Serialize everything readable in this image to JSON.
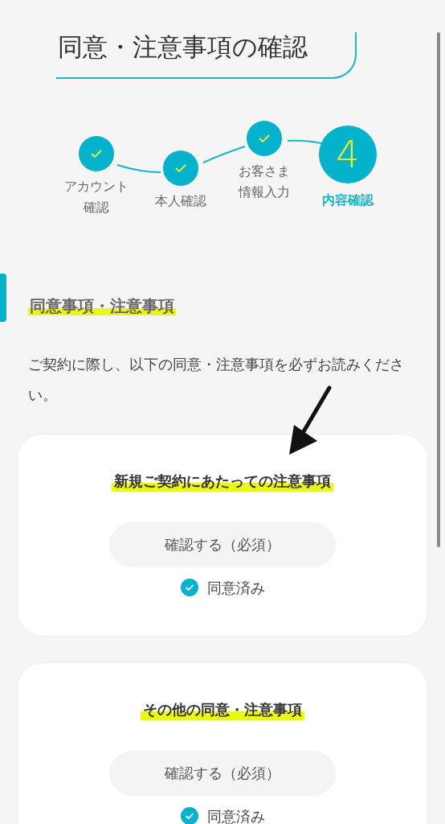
{
  "page_title": "同意・注意事項の確認",
  "steps": [
    {
      "label_lines": [
        "アカウント",
        "確認"
      ],
      "done": true,
      "current": false
    },
    {
      "label_lines": [
        "本人確認"
      ],
      "done": true,
      "current": false
    },
    {
      "label_lines": [
        "お客さま",
        "情報入力"
      ],
      "done": true,
      "current": false
    },
    {
      "label_lines": [
        "内容確認"
      ],
      "number": "4",
      "done": false,
      "current": true
    }
  ],
  "section_heading": "同意事項・注意事項",
  "intro": "ご契約に際し、以下の同意・注意事項を必ずお読みください。",
  "items": [
    {
      "title": "新規ご契約にあたっての注意事項",
      "button": "確認する（必須）",
      "status": "同意済み",
      "agreed": true
    },
    {
      "title": "その他の同意・注意事項",
      "button": "確認する（必須）",
      "status": "同意済み",
      "agreed": true
    }
  ]
}
